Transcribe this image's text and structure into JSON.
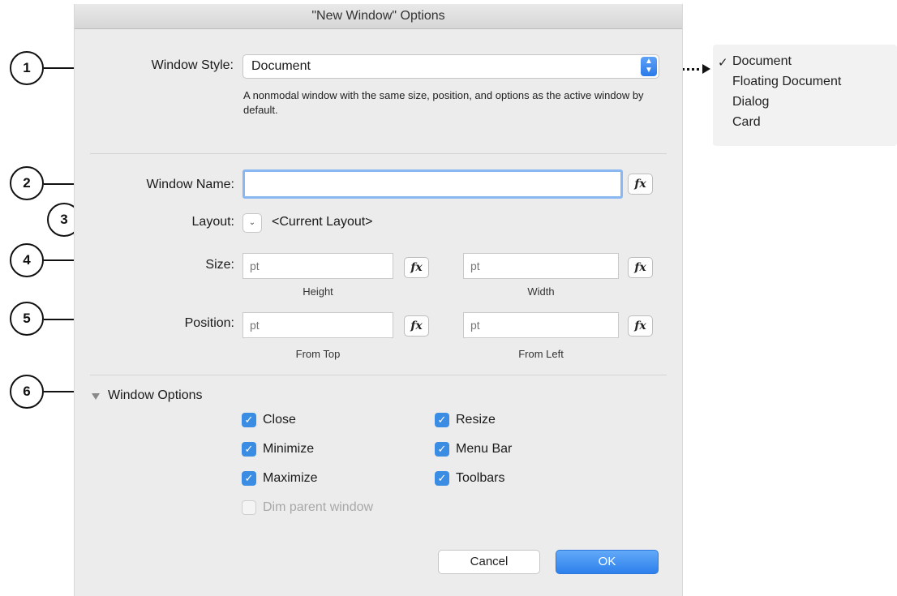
{
  "dialog": {
    "title": "\"New Window\" Options"
  },
  "window_style": {
    "label": "Window Style:",
    "value": "Document",
    "description": "A nonmodal window with the same size, position, and options as the active window by default."
  },
  "window_name": {
    "label": "Window Name:",
    "value": "",
    "fx_label": "fx"
  },
  "layout": {
    "label": "Layout:",
    "value": "<Current Layout>"
  },
  "size": {
    "label": "Size:",
    "height_placeholder": "pt",
    "height_caption": "Height",
    "width_placeholder": "pt",
    "width_caption": "Width",
    "fx_label": "fx"
  },
  "position": {
    "label": "Position:",
    "top_placeholder": "pt",
    "top_caption": "From Top",
    "left_placeholder": "pt",
    "left_caption": "From Left",
    "fx_label": "fx"
  },
  "window_options": {
    "label": "Window Options",
    "checkboxes": [
      {
        "label": "Close",
        "checked": true,
        "enabled": true
      },
      {
        "label": "Minimize",
        "checked": true,
        "enabled": true
      },
      {
        "label": "Maximize",
        "checked": true,
        "enabled": true
      },
      {
        "label": "Dim parent window",
        "checked": false,
        "enabled": false
      },
      {
        "label": "Resize",
        "checked": true,
        "enabled": true
      },
      {
        "label": "Menu Bar",
        "checked": true,
        "enabled": true
      },
      {
        "label": "Toolbars",
        "checked": true,
        "enabled": true
      }
    ]
  },
  "buttons": {
    "cancel": "Cancel",
    "ok": "OK"
  },
  "style_menu": {
    "items": [
      "Document",
      "Floating Document",
      "Dialog",
      "Card"
    ],
    "selected": "Document",
    "check": "✓"
  },
  "callouts": [
    "1",
    "2",
    "3",
    "4",
    "5",
    "6"
  ],
  "colors": {
    "accent": "#3b8de4",
    "dialog_bg": "#ececec"
  }
}
